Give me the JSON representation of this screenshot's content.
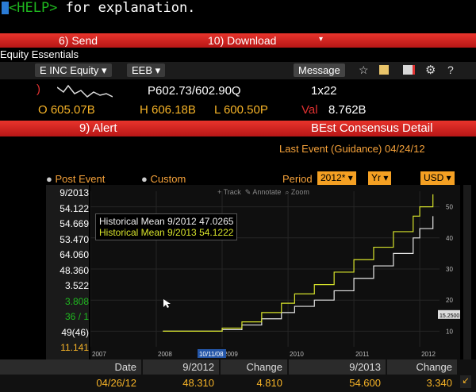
{
  "command_line": {
    "prefix": "<HELP>",
    "text": " for explanation."
  },
  "function_bar": {
    "send": "6) Send",
    "download": "10) Download"
  },
  "window_title": "Equity Essentials",
  "toolbar": {
    "ticker": "E INC Equity",
    "exchange": "EEB",
    "message": "Message",
    "icons": [
      "star-icon",
      "save-icon",
      "export-icon",
      "gear-icon",
      "help-icon"
    ],
    "help_label": "?"
  },
  "quote": {
    "last": "P602.73/602.90Q",
    "size": "1x22",
    "open": "O 605.07B",
    "high": "H 606.18B",
    "low": "L 600.50P",
    "val_label": "Val",
    "val": "8.762B"
  },
  "alert_bar": {
    "alert": "9) Alert",
    "title": "BEst Consensus Detail"
  },
  "last_event": "Last Event (Guidance) 04/24/12",
  "controls": {
    "post_event": "Post Event",
    "custom": "Custom",
    "period_label": "Period",
    "period_value": "2012",
    "freq_value": "Yr",
    "currency_value": "USD"
  },
  "side_values": [
    "9/2013",
    "54.122",
    "54.669",
    "53.470",
    "64.060",
    "48.360",
    "3.522",
    "3.808",
    "36 / 1",
    "49(46)",
    "11.141"
  ],
  "chart_toolbar": {
    "track": "Track",
    "annotate": "Annotate",
    "zoom": "Zoom"
  },
  "legend": {
    "line1": "Historical Mean 9/2012 47.0265",
    "line2": "Historical Mean 9/2013 54.1222"
  },
  "chart_data": {
    "type": "line",
    "x": [
      "2007",
      "2008",
      "2009",
      "2010",
      "2011",
      "2012"
    ],
    "y_ticks": [
      10,
      20,
      30,
      40,
      50
    ],
    "series": [
      {
        "name": "Historical Mean 9/2012",
        "color": "#e6e6e6",
        "points": [
          [
            2008.1,
            10
          ],
          [
            2008.6,
            10
          ],
          [
            2009.0,
            10.5
          ],
          [
            2009.3,
            12
          ],
          [
            2009.6,
            14
          ],
          [
            2009.9,
            16
          ],
          [
            2010.1,
            18
          ],
          [
            2010.4,
            20
          ],
          [
            2010.7,
            23
          ],
          [
            2011.0,
            27
          ],
          [
            2011.3,
            31
          ],
          [
            2011.6,
            35
          ],
          [
            2011.9,
            40
          ],
          [
            2012.0,
            43
          ],
          [
            2012.2,
            47
          ]
        ]
      },
      {
        "name": "Historical Mean 9/2013",
        "color": "#d7e32b",
        "points": [
          [
            2008.1,
            10
          ],
          [
            2008.6,
            10
          ],
          [
            2009.0,
            11
          ],
          [
            2009.3,
            13
          ],
          [
            2009.6,
            16
          ],
          [
            2009.9,
            19
          ],
          [
            2010.1,
            22
          ],
          [
            2010.4,
            25
          ],
          [
            2010.7,
            29
          ],
          [
            2011.0,
            33
          ],
          [
            2011.3,
            37
          ],
          [
            2011.6,
            42
          ],
          [
            2011.9,
            47
          ],
          [
            2012.0,
            50
          ],
          [
            2012.2,
            54
          ]
        ]
      }
    ],
    "ylim": [
      5,
      55
    ],
    "xlim": [
      2007,
      2012.3
    ],
    "markers": {
      "x_label": "10/11/08",
      "y_label": "15.2500"
    }
  },
  "table": {
    "headers": [
      "Date",
      "9/2012",
      "Change",
      "9/2013",
      "Change"
    ],
    "row": [
      "04/26/12",
      "48.310",
      "4.810",
      "54.600",
      "3.340"
    ]
  }
}
